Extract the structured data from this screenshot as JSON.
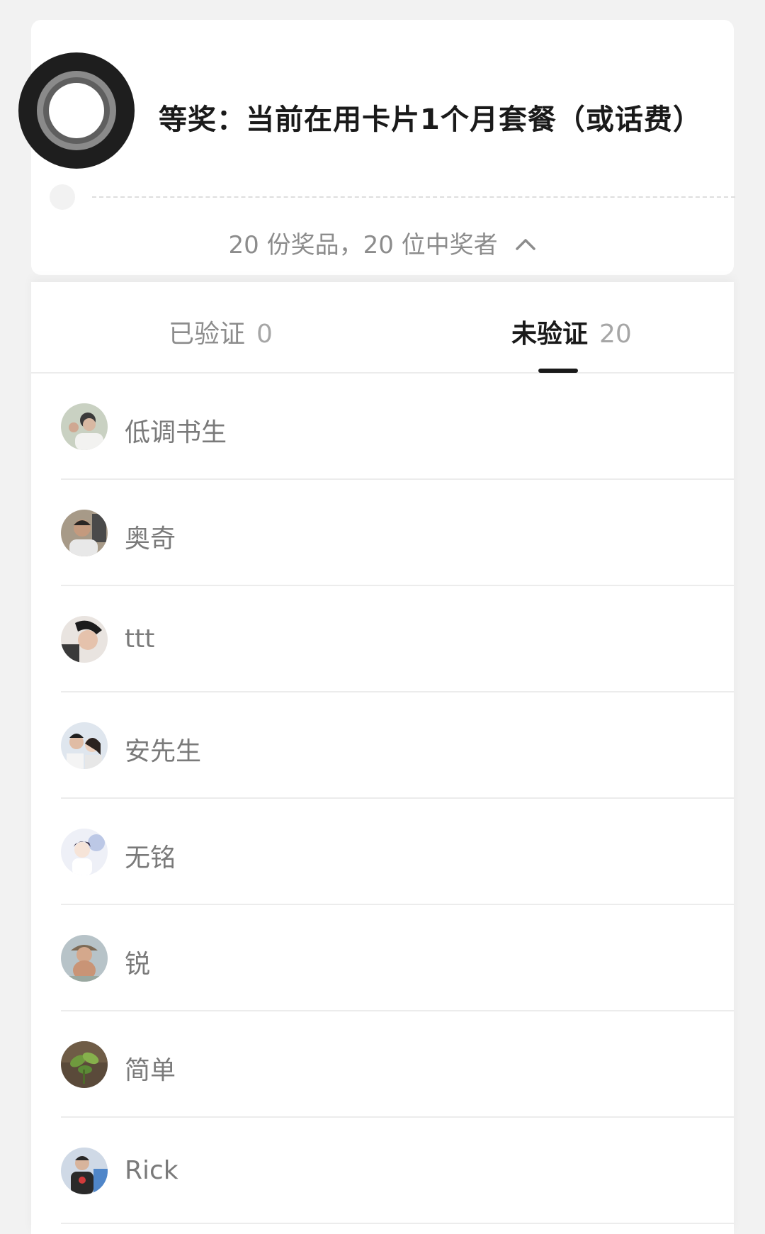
{
  "prize": {
    "title": "等奖：当前在用卡片1个月套餐（或话费）",
    "summary": "20 份奖品，20 位中奖者"
  },
  "tabs": [
    {
      "label": "已验证",
      "count": "0"
    },
    {
      "label": "未验证",
      "count": "20"
    }
  ],
  "winners": [
    {
      "name": "低调书生"
    },
    {
      "name": "奥奇"
    },
    {
      "name": "ttt"
    },
    {
      "name": "安先生"
    },
    {
      "name": "无铭"
    },
    {
      "name": "锐"
    },
    {
      "name": "简单"
    },
    {
      "name": "Rick"
    }
  ],
  "icons": {
    "expand": "chevron-up-icon",
    "assistive": "assistive-touch-icon"
  }
}
